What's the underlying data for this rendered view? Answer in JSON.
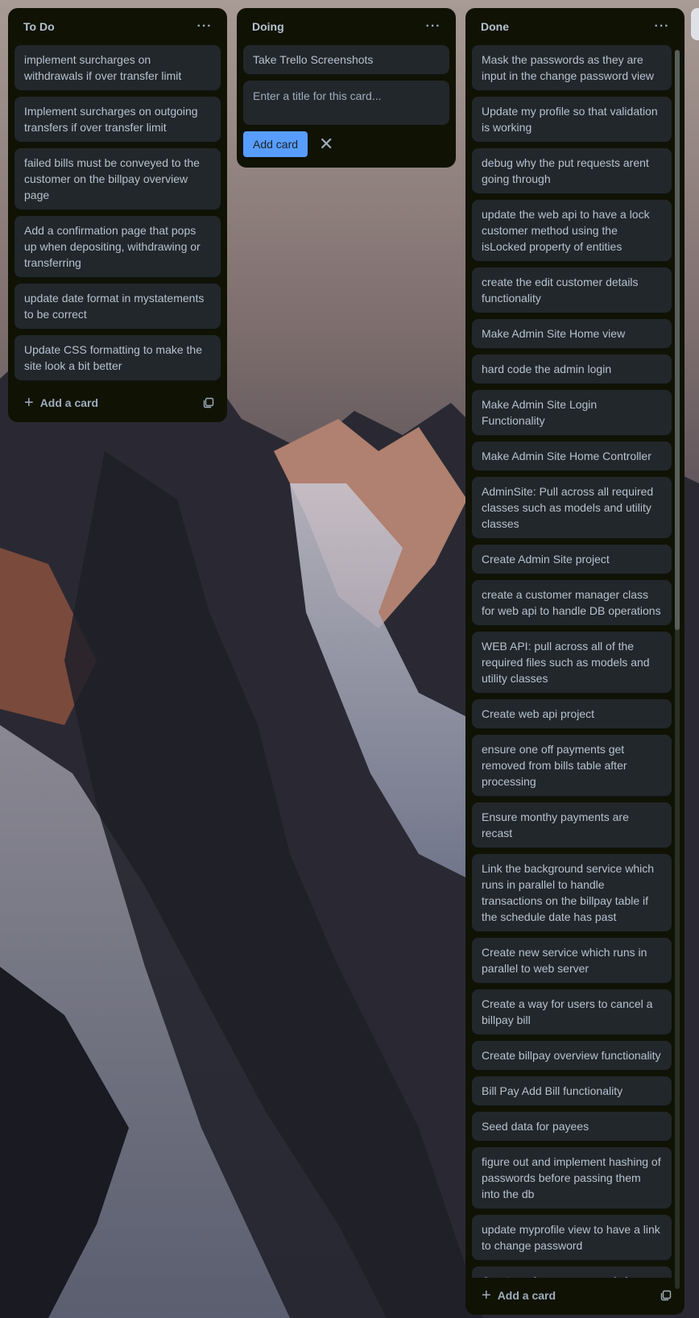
{
  "lists": {
    "todo": {
      "title": "To Do",
      "menu_glyph": "···",
      "cards": [
        "implement surcharges on withdrawals if over transfer limit",
        "Implement surcharges on outgoing transfers if over transfer limit",
        "failed bills must be conveyed to the customer on the billpay overview page",
        "Add a confirmation page that pops up when depositing, withdrawing or transferring",
        "update date format in mystatements to be correct",
        "Update CSS formatting to make the site look a bit better"
      ],
      "add_card_label": "Add a card"
    },
    "doing": {
      "title": "Doing",
      "menu_glyph": "···",
      "cards": [
        "Take Trello Screenshots"
      ],
      "composer_placeholder": "Enter a title for this card...",
      "add_button_label": "Add card",
      "close_glyph": "✕"
    },
    "done": {
      "title": "Done",
      "menu_glyph": "···",
      "cards": [
        "Mask the passwords as they are input in the change password view",
        "Update my profile so that validation is working",
        "debug why the put requests arent going through",
        "update the web api to have a lock customer method using the isLocked property of entities",
        "create the edit customer details functionality",
        "Make Admin Site Home view",
        "hard code the admin login",
        "Make Admin Site Login Functionality",
        "Make Admin Site Home Controller",
        "AdminSite: Pull across all required classes such as models and utility classes",
        "Create Admin Site project",
        "create a customer manager class for web api to handle DB operations",
        "WEB API: pull across all of the required files such as models and utility classes",
        "Create web api project",
        "ensure one off payments get removed from bills table after processing",
        "Ensure monthy payments are recast",
        "Link the background service which runs in parallel to handle transactions on the billpay table if the schedule date has past",
        "Create new service which runs in parallel to web server",
        "Create a way for users to cancel a billpay bill",
        "Create billpay overview functionality",
        "Bill Pay Add Bill functionality",
        "Seed data for payees",
        "figure out and implement hashing of passwords before passing them into the db",
        "update myprofile view to have a link to change password",
        "Create a change password view"
      ],
      "add_card_label": "Add a card"
    }
  },
  "colors": {
    "list_bg": "#101204",
    "card_bg": "#22272b",
    "text": "#b6c2cf",
    "accent": "#579dff"
  },
  "icons": [
    "ellipsis-icon",
    "plus-icon",
    "template-icon",
    "close-icon"
  ]
}
